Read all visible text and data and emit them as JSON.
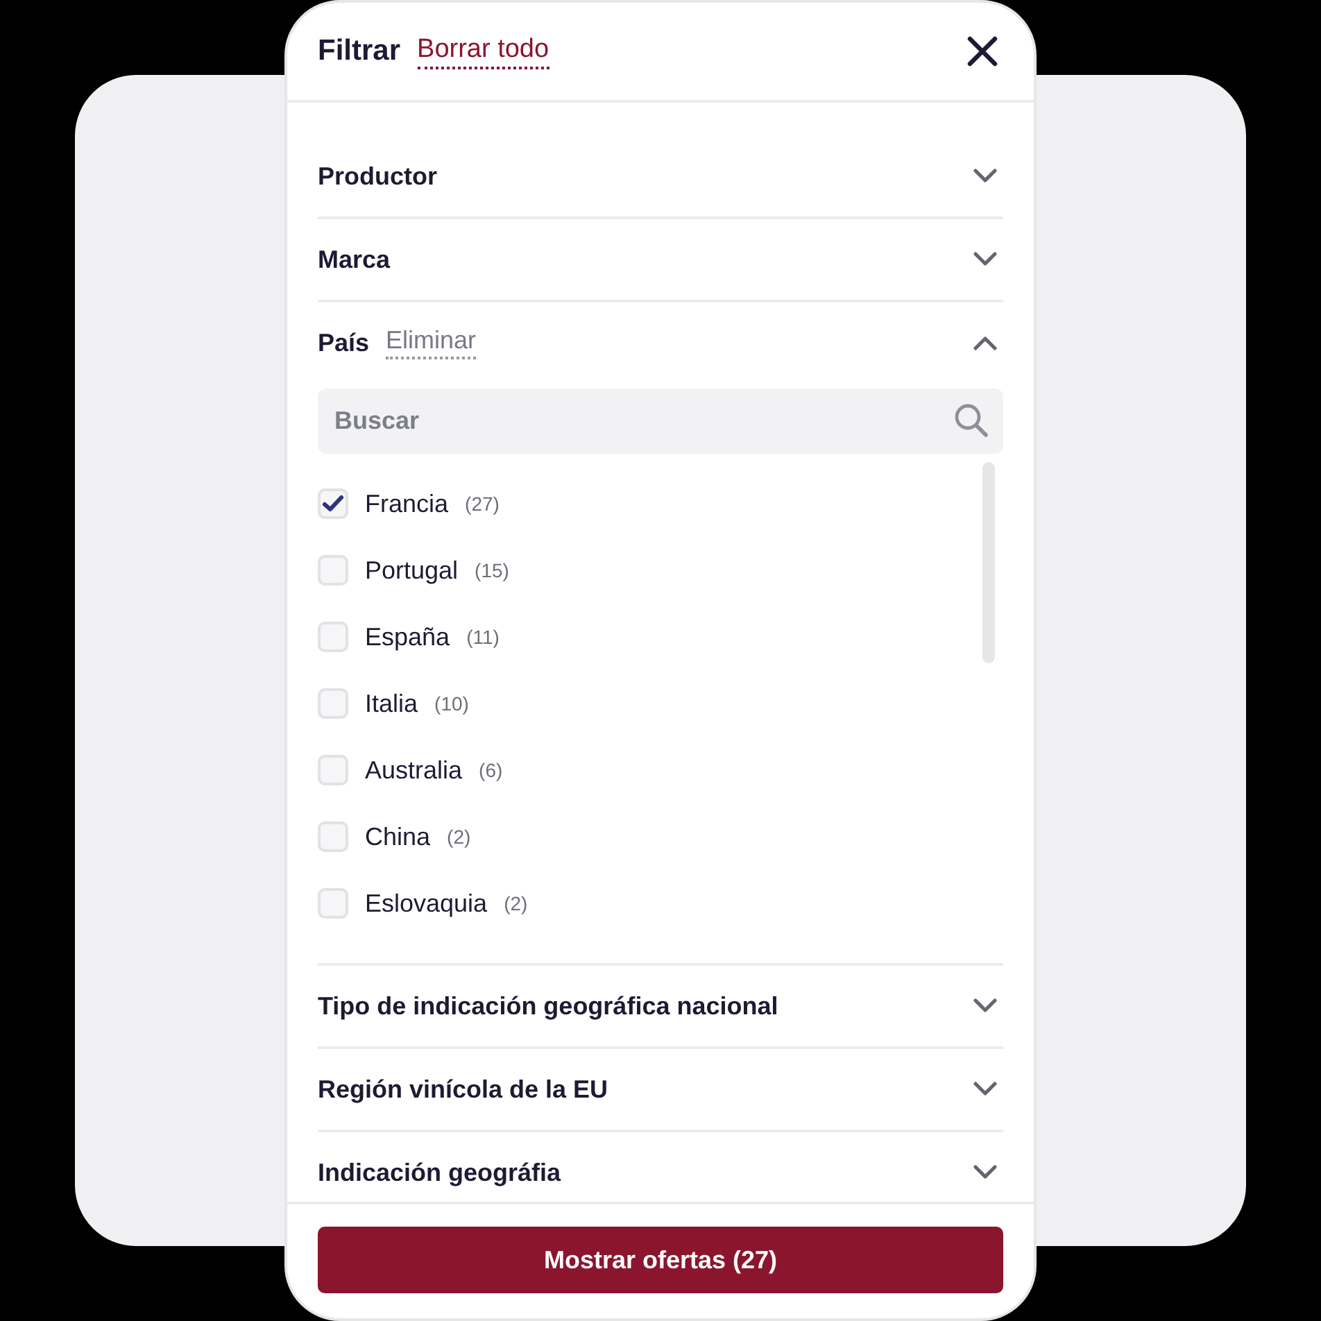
{
  "header": {
    "title": "Filtrar",
    "clear_all": "Borrar todo"
  },
  "sections": [
    {
      "title": "Productor",
      "expanded": false
    },
    {
      "title": "Marca",
      "expanded": false
    },
    {
      "title": "País",
      "expanded": true,
      "clear": "Eliminar",
      "search": {
        "placeholder": "Buscar"
      },
      "options": [
        {
          "label": "Francia",
          "count": "(27)",
          "checked": true
        },
        {
          "label": "Portugal",
          "count": "(15)",
          "checked": false
        },
        {
          "label": "España",
          "count": "(11)",
          "checked": false
        },
        {
          "label": "Italia",
          "count": "(10)",
          "checked": false
        },
        {
          "label": "Australia",
          "count": "(6)",
          "checked": false
        },
        {
          "label": "China",
          "count": "(2)",
          "checked": false
        },
        {
          "label": "Eslovaquia",
          "count": "(2)",
          "checked": false
        }
      ]
    },
    {
      "title": "Tipo de indicación geográfica nacional",
      "expanded": false
    },
    {
      "title": "Región vinícola de la EU",
      "expanded": false
    },
    {
      "title": "Indicación geográfia",
      "expanded": false
    }
  ],
  "submit": "Mostrar ofertas (27)"
}
